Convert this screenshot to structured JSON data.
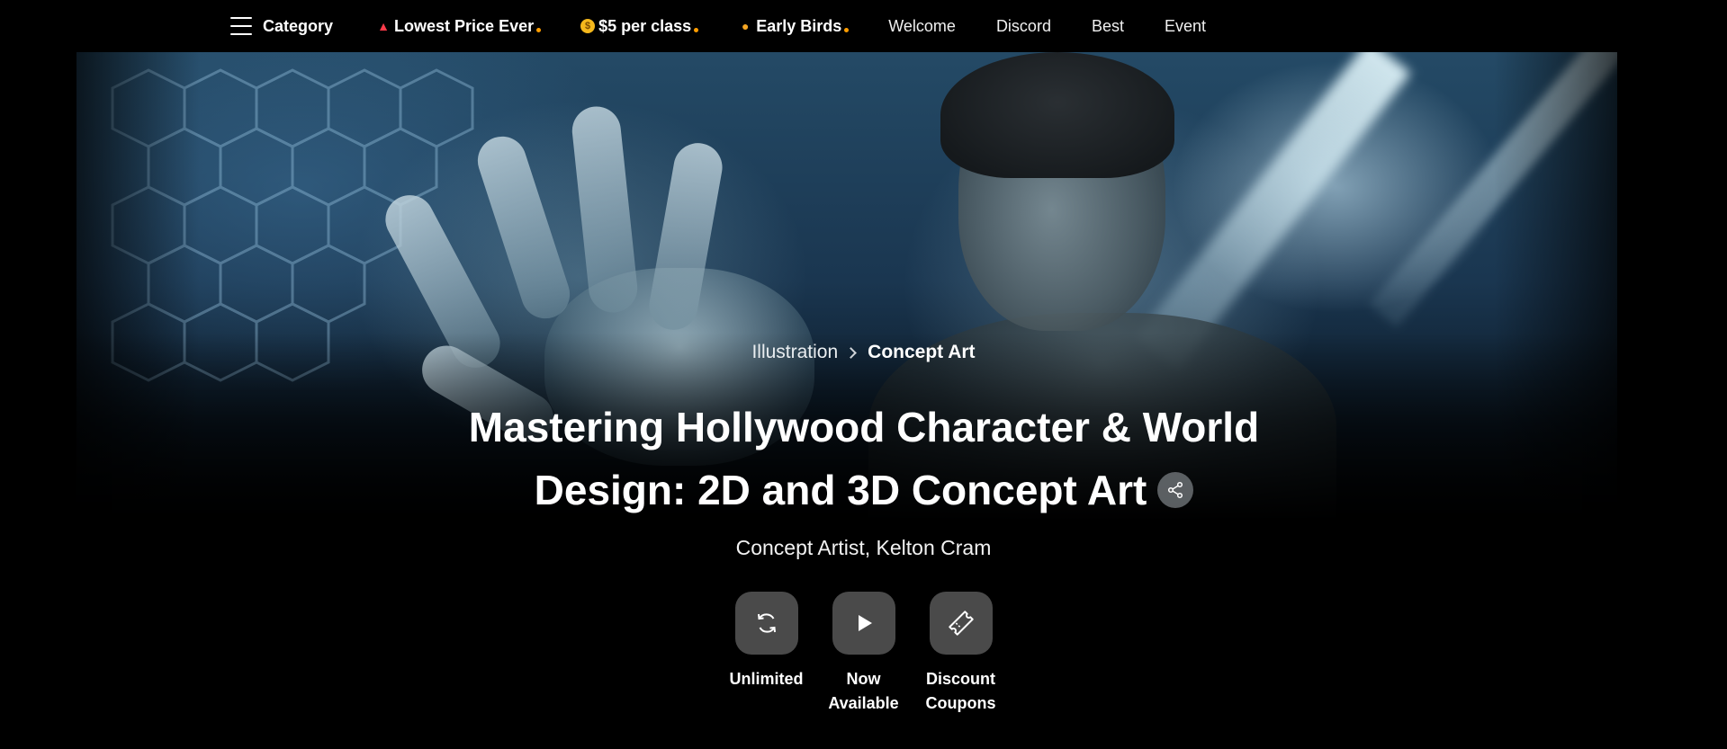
{
  "nav": {
    "category_label": "Category",
    "promos": [
      {
        "icon": "siren-icon",
        "label": "Lowest Price Ever"
      },
      {
        "icon": "money-face-icon",
        "label": "$5 per class"
      },
      {
        "icon": "chick-icon",
        "label": "Early Birds"
      }
    ],
    "links": [
      "Welcome",
      "Discord",
      "Best",
      "Event"
    ],
    "promo_dot_color": "#ff9d00"
  },
  "breadcrumb": {
    "parent": "Illustration",
    "current": "Concept Art"
  },
  "course": {
    "title_line1": "Mastering Hollywood Character & World",
    "title_line2": "Design: 2D and 3D Concept Art",
    "instructor": "Concept Artist, Kelton Cram"
  },
  "features": [
    {
      "icon": "refresh-icon",
      "line1": "Unlimited",
      "line2": ""
    },
    {
      "icon": "play-icon",
      "line1": "Now",
      "line2": "Available"
    },
    {
      "icon": "ticket-icon",
      "line1": "Discount",
      "line2": "Coupons"
    }
  ],
  "hero_image": {
    "description_icon": "hero-banner-image"
  }
}
